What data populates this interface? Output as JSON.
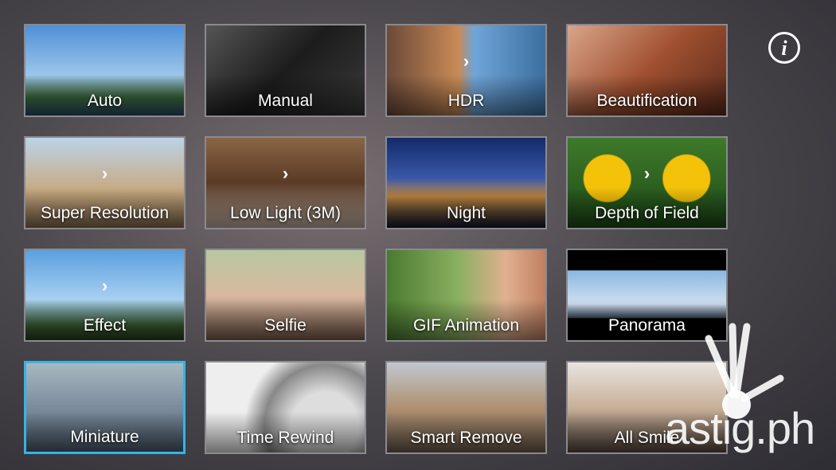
{
  "modes": [
    {
      "label": "Auto",
      "bg": "linear-gradient(180deg,#4f8fd8 0%,#9cc6ea 55%,#3d6b3a 80%,#2b4d6b 100%)",
      "arrow": false
    },
    {
      "label": "Manual",
      "bg": "linear-gradient(135deg,#555 0%,#1c1c1c 50%,#3a3a3a 100%)",
      "arrow": false
    },
    {
      "label": "HDR",
      "bg": "linear-gradient(90deg,#6b4a3a 0%,#c98a55 45%,#6fa5d8 55%,#3c6fa0 100%)",
      "arrow": true
    },
    {
      "label": "Beautification",
      "bg": "linear-gradient(135deg,#d9a58a 0%,#a05030 50%,#5a2a1a 100%)",
      "arrow": false
    },
    {
      "label": "Super Resolution",
      "bg": "linear-gradient(180deg,#bcd3e8 0%,#c7a980 60%,#8a7050 100%)",
      "arrow": true
    },
    {
      "label": "Low Light (3M)",
      "bg": "linear-gradient(180deg,#8a6545 0%,#5a3a25 50%,#c9b7a8 100%)",
      "arrow": true
    },
    {
      "label": "Night",
      "bg": "linear-gradient(180deg,#132a6a 0%,#3a58a8 45%,#c48a40 65%,#101830 100%)",
      "arrow": false
    },
    {
      "label": "Depth of Field",
      "bg": "radial-gradient(circle at 25% 45%,#f5c20a 0 18%,transparent 19%),radial-gradient(circle at 75% 45%,#f5c20a 0 18%,transparent 19%),linear-gradient(180deg,#3e7a2a,#1e4a18)",
      "arrow": true
    },
    {
      "label": "Effect",
      "bg": "linear-gradient(180deg,#5aa0e0 0%,#a8d0f0 55%,#3a6030 85%,#2a4020 100%)",
      "arrow": true
    },
    {
      "label": "Selfie",
      "bg": "linear-gradient(180deg,#b8c8a0 0%,#d9b8a0 50%,#806050 100%)",
      "arrow": false
    },
    {
      "label": "GIF Animation",
      "bg": "linear-gradient(90deg,#4a7a30 0%,#8ab060 45%,#e0b090 75%,#c08060 100%)",
      "arrow": false
    },
    {
      "label": "Panorama",
      "bg": "linear-gradient(180deg,#000 0%,#000 22%,#8ab8e0 23%,#d0e0f0 60%,#3a4a5a 75%,#000 76%)",
      "arrow": false
    },
    {
      "label": "Miniature",
      "bg": "linear-gradient(180deg,#a8b8c0 0%,#8090a0 45%,#506070 100%)",
      "arrow": false,
      "selected": true
    },
    {
      "label": "Time Rewind",
      "bg": "radial-gradient(circle at 75% 70%,#ddd 0 25%,#888 45%,#eee 60%),linear-gradient(#ccc,#777)",
      "arrow": false
    },
    {
      "label": "Smart Remove",
      "bg": "linear-gradient(180deg,#c0c8d0 0%,#b09070 50%,#706050 100%)",
      "arrow": false
    },
    {
      "label": "All Smile",
      "bg": "linear-gradient(180deg,#e8e4df 0%,#c8b09a 50%,#5a4a40 100%)",
      "arrow": false
    }
  ],
  "info_icon": "info-icon",
  "accent_selected": "#35b4e6",
  "watermark": "astig.ph"
}
